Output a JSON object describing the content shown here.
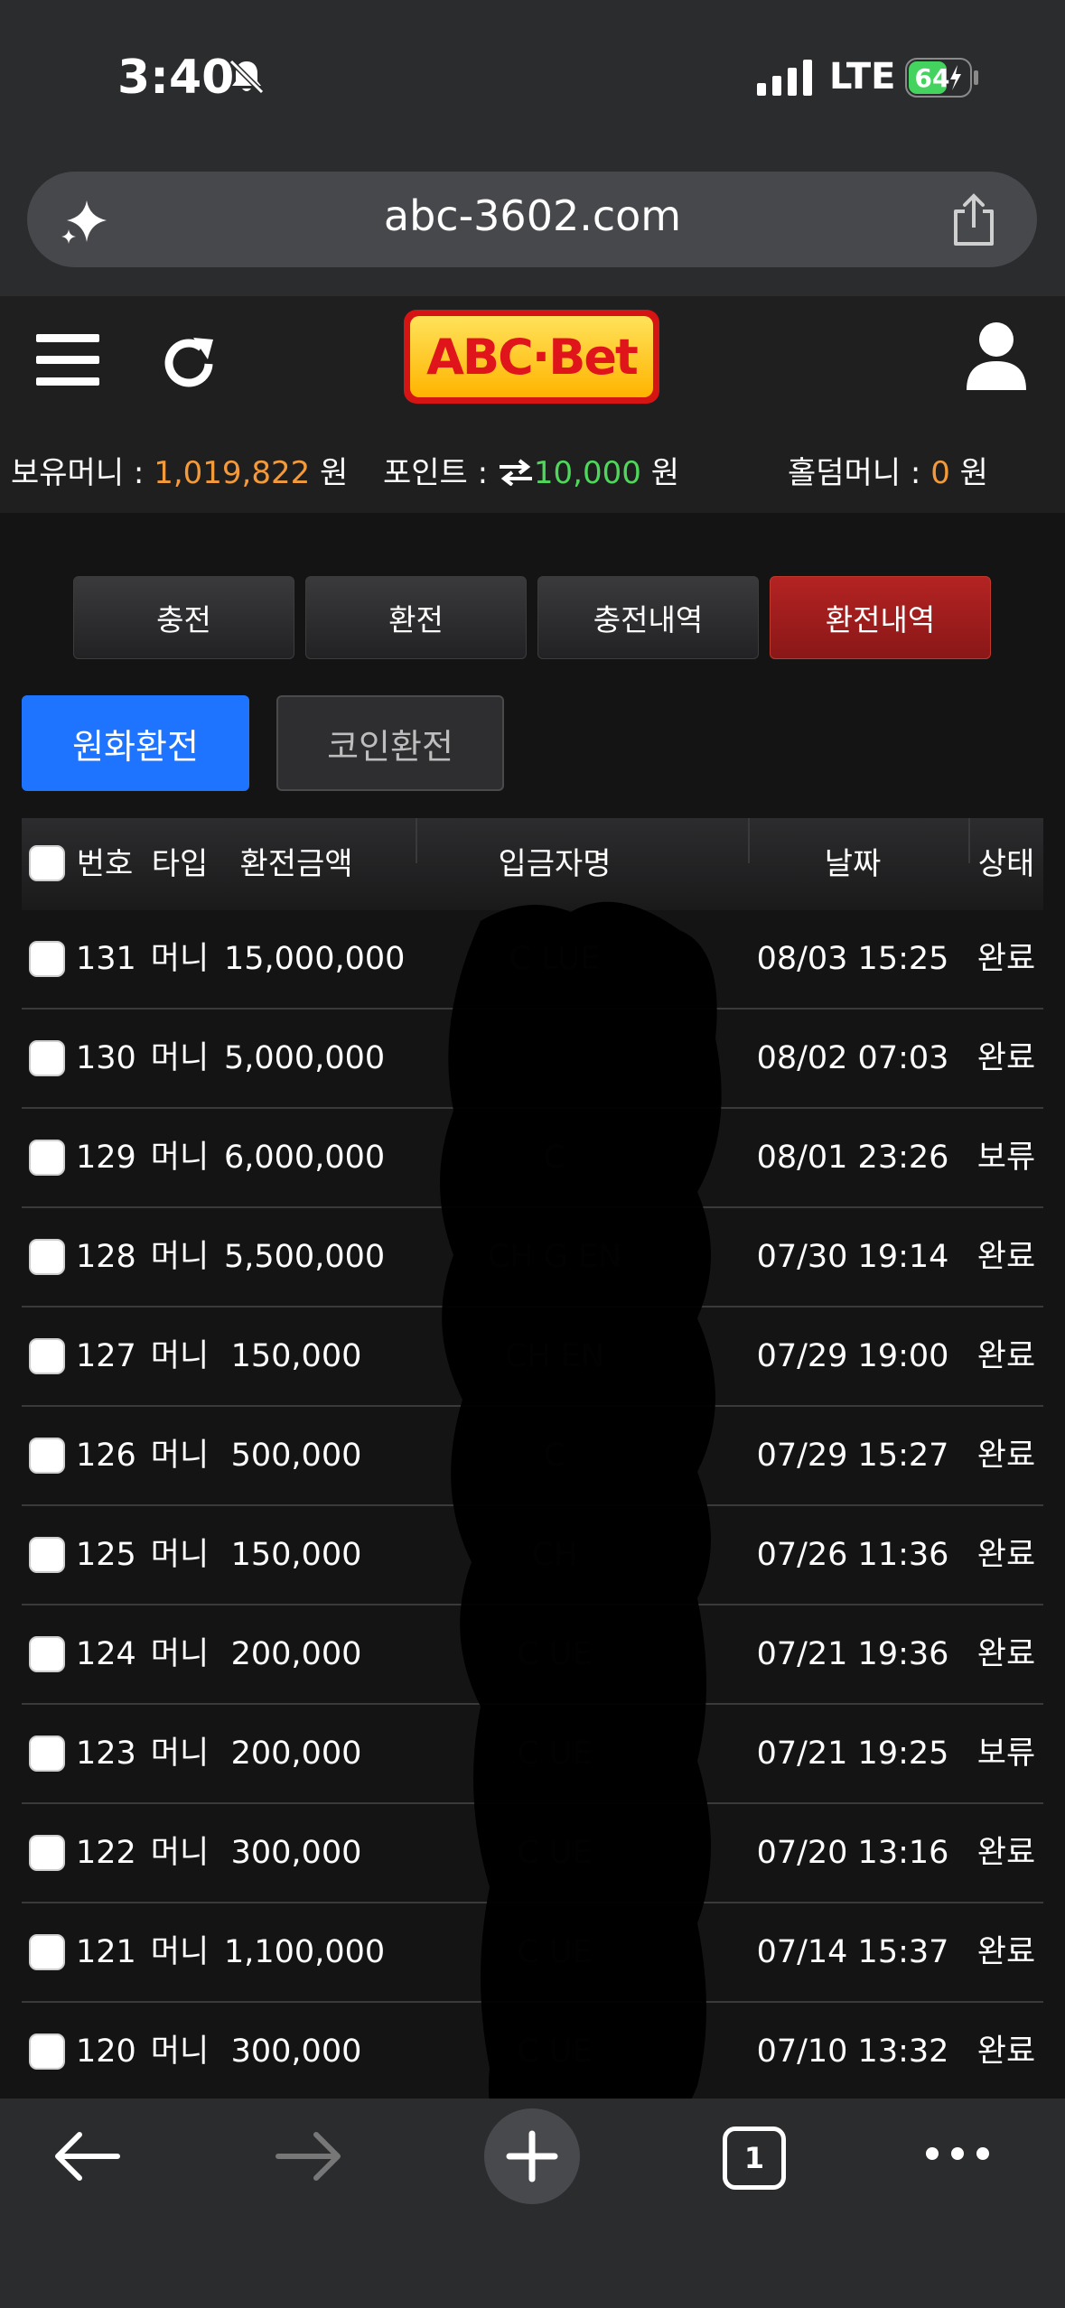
{
  "status": {
    "time": "3:40",
    "network": "LTE",
    "battery": "64",
    "battery_level": 0.64
  },
  "browser": {
    "url": "abc-3602.com",
    "open_tabs": "1"
  },
  "site": {
    "logo_text": "ABC·Bet",
    "balances": [
      {
        "label": "보유머니 : ",
        "value": "1,019,822",
        "unit": " 원",
        "color": "#f39a3b"
      },
      {
        "label": "포인트 : ",
        "icon": "swap-arrows-icon",
        "value": "10,000",
        "unit": " 원",
        "color": "#4fd75b"
      },
      {
        "label": "홀덤머니 : ",
        "value": "0",
        "unit": " 원",
        "color": "#f39a3b"
      }
    ]
  },
  "tabs": [
    {
      "label": "충전",
      "active": false
    },
    {
      "label": "환전",
      "active": false
    },
    {
      "label": "충전내역",
      "active": false
    },
    {
      "label": "환전내역",
      "active": true
    }
  ],
  "subtabs": [
    {
      "label": "원화환전",
      "active": true
    },
    {
      "label": "코인환전",
      "active": false
    }
  ],
  "table": {
    "headers": [
      "번호",
      "타입",
      "환전금액",
      "입금자명",
      "날짜",
      "상태"
    ],
    "rows": [
      {
        "no": "131",
        "type": "머니",
        "amount": "15,000,000",
        "name": "C      LUE",
        "date": "08/03 15:25",
        "status": "완료"
      },
      {
        "no": "130",
        "type": "머니",
        "amount": "5,000,000",
        "name": "",
        "date": "08/02 07:03",
        "status": "완료"
      },
      {
        "no": "129",
        "type": "머니",
        "amount": "6,000,000",
        "name": "C",
        "date": "08/01 23:26",
        "status": "보류"
      },
      {
        "no": "128",
        "type": "머니",
        "amount": "5,500,000",
        "name": "CH      G     EN",
        "date": "07/30 19:14",
        "status": "완료"
      },
      {
        "no": "127",
        "type": "머니",
        "amount": "150,000",
        "name": "CH          EN",
        "date": "07/29 19:00",
        "status": "완료"
      },
      {
        "no": "126",
        "type": "머니",
        "amount": "500,000",
        "name": "C",
        "date": "07/29 15:27",
        "status": "완료"
      },
      {
        "no": "125",
        "type": "머니",
        "amount": "150,000",
        "name": "CH",
        "date": "07/26 11:36",
        "status": "완료"
      },
      {
        "no": "124",
        "type": "머니",
        "amount": "200,000",
        "name": "C        UE",
        "date": "07/21 19:36",
        "status": "완료"
      },
      {
        "no": "123",
        "type": "머니",
        "amount": "200,000",
        "name": "C        UE",
        "date": "07/21 19:25",
        "status": "보류"
      },
      {
        "no": "122",
        "type": "머니",
        "amount": "300,000",
        "name": "C        UE",
        "date": "07/20 13:16",
        "status": "완료"
      },
      {
        "no": "121",
        "type": "머니",
        "amount": "1,100,000",
        "name": "C        UE",
        "date": "07/14 15:37",
        "status": "완료"
      },
      {
        "no": "120",
        "type": "머니",
        "amount": "300,000",
        "name": "C        UE",
        "date": "07/10 13:32",
        "status": "완료"
      }
    ]
  },
  "colors": {
    "active_tab": "#a11d1d",
    "active_subtab": "#1e74ff",
    "money_value": "#f39a3b",
    "point_value": "#4fd75b"
  }
}
